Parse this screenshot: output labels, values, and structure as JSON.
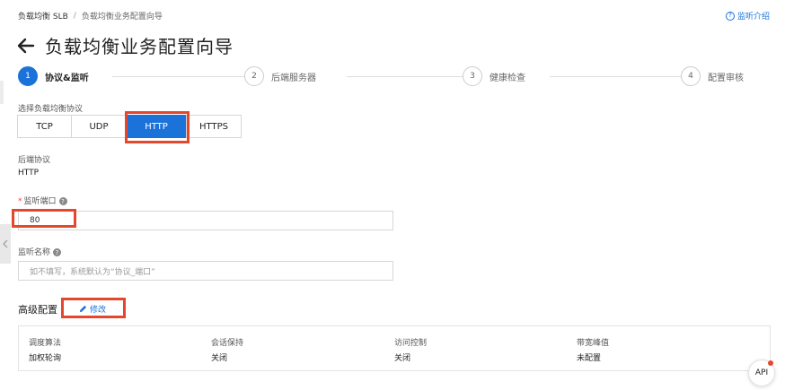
{
  "breadcrumb": {
    "root": "负载均衡 SLB",
    "separator": "/",
    "current": "负载均衡业务配置向导"
  },
  "help": {
    "icon_glyph": "?",
    "label": "监听介绍"
  },
  "page": {
    "title": "负载均衡业务配置向导"
  },
  "steps": [
    {
      "num": "1",
      "label": "协议&监听",
      "active": true
    },
    {
      "num": "2",
      "label": "后端服务器",
      "active": false
    },
    {
      "num": "3",
      "label": "健康检查",
      "active": false
    },
    {
      "num": "4",
      "label": "配置审核",
      "active": false
    }
  ],
  "protocol": {
    "label": "选择负载均衡协议",
    "options": [
      "TCP",
      "UDP",
      "HTTP",
      "HTTPS"
    ],
    "selected": "HTTP"
  },
  "backend": {
    "label": "后端协议",
    "value": "HTTP"
  },
  "port": {
    "required_mark": "*",
    "label": "监听端口",
    "value": "80"
  },
  "listener_name": {
    "label": "监听名称",
    "placeholder": "如不填写，系统默认为“协议_端口”"
  },
  "advanced": {
    "title": "高级配置",
    "edit_label": "修改",
    "columns": [
      {
        "header": "调度算法",
        "value": "加权轮询"
      },
      {
        "header": "会话保持",
        "value": "关闭"
      },
      {
        "header": "访问控制",
        "value": "关闭"
      },
      {
        "header": "带宽峰值",
        "value": "未配置"
      }
    ]
  },
  "api": {
    "label": "API"
  },
  "colors": {
    "primary": "#1b73d9",
    "highlight": "#e5472d"
  }
}
